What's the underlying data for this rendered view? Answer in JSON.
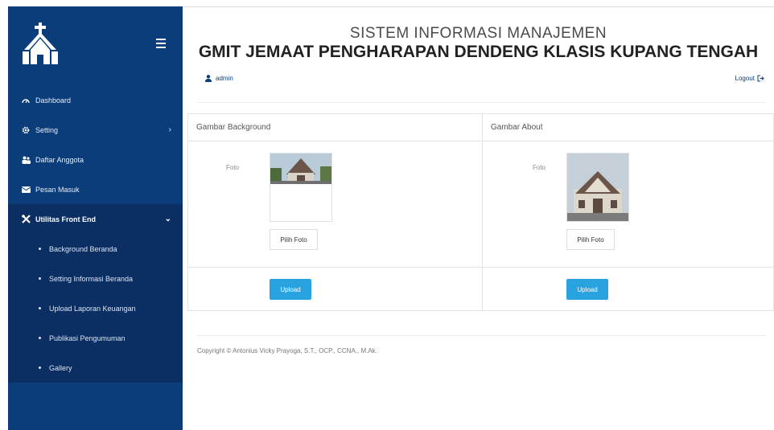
{
  "sidebar": {
    "items": [
      {
        "label": "Dashboard",
        "icon": "dashboard-icon"
      },
      {
        "label": "Setting",
        "icon": "gear-icon",
        "chevron": "›"
      },
      {
        "label": "Daftar Anggota",
        "icon": "users-icon"
      },
      {
        "label": "Pesan Masuk",
        "icon": "envelope-icon"
      },
      {
        "label": "Utilitas Front End",
        "icon": "tools-icon",
        "chevron": "⌄"
      }
    ],
    "subitems": [
      {
        "label": "Background Beranda"
      },
      {
        "label": "Setting Informasi Beranda"
      },
      {
        "label": "Upload Laporan Keuangan"
      },
      {
        "label": "Publikasi Pengumuman"
      },
      {
        "label": "Gallery"
      }
    ]
  },
  "header": {
    "title_line1": "SISTEM INFORMASI MANAJEMEN",
    "title_line2": "GMIT JEMAAT PENGHARAPAN DENDENG KLASIS KUPANG TENGAH",
    "user": "admin",
    "logout": "Logout"
  },
  "panels": [
    {
      "title": "Gambar Background",
      "foto_label": "Foto",
      "pick_label": "Pilih Foto",
      "upload_label": "Upload"
    },
    {
      "title": "Gambar About",
      "foto_label": "Foto",
      "pick_label": "Pilih Foto",
      "upload_label": "Upload"
    }
  ],
  "footer": {
    "copyright": "Copyright © Antonius Vicky Prayoga, S.T., OCP., CCNA., M.Ak."
  },
  "colors": {
    "sidebar": "#0a3d7a",
    "sidebar_active": "#0b2f63",
    "accent": "#29a3e0"
  }
}
